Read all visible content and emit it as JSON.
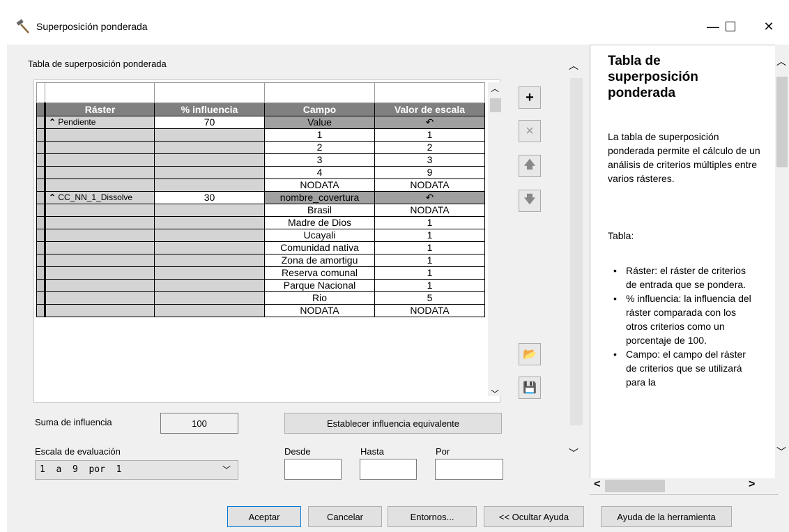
{
  "window": {
    "title": "Superposición ponderada",
    "minimize_icon": "minimize-icon",
    "maximize_icon": "maximize-icon",
    "close_icon": "close-icon"
  },
  "table_title": "Tabla de superposición ponderada",
  "headers": [
    "Ráster",
    "% influencia",
    "Campo",
    "Valor de escala"
  ],
  "rows": [
    {
      "type": "raster",
      "raster": "Pendiente",
      "influence": "70",
      "field": "Value",
      "scale": "↶"
    },
    {
      "type": "value",
      "field": "1",
      "scale": "1"
    },
    {
      "type": "value",
      "field": "2",
      "scale": "2"
    },
    {
      "type": "value",
      "field": "3",
      "scale": "3"
    },
    {
      "type": "value",
      "field": "4",
      "scale": "9"
    },
    {
      "type": "value",
      "field": "NODATA",
      "scale": "NODATA"
    },
    {
      "type": "raster",
      "raster": "CC_NN_1_Dissolve",
      "influence": "30",
      "field": "nombre_covertura",
      "scale": "↶"
    },
    {
      "type": "value",
      "field": "Brasil",
      "scale": "NODATA"
    },
    {
      "type": "value",
      "field": "Madre de Dios",
      "scale": "1"
    },
    {
      "type": "value",
      "field": "Ucayali",
      "scale": "1"
    },
    {
      "type": "value",
      "field": "Comunidad nativa",
      "scale": "1"
    },
    {
      "type": "value",
      "field": "Zona de amortigu",
      "scale": "1"
    },
    {
      "type": "value",
      "field": "Reserva comunal",
      "scale": "1"
    },
    {
      "type": "value",
      "field": "Parque Nacional",
      "scale": "1"
    },
    {
      "type": "value",
      "field": "Rio",
      "scale": "5"
    },
    {
      "type": "value",
      "field": "NODATA",
      "scale": "NODATA"
    }
  ],
  "side_buttons": {
    "add": "+",
    "remove": "×",
    "up": "🡅",
    "down": "🡇",
    "open": "📂",
    "save": "💾"
  },
  "sum_label": "Suma de influencia",
  "sum_value": "100",
  "equal_influence_button": "Establecer influencia equivalente",
  "scale_label": "Escala de evaluación",
  "scale_value": "1  a  9  por  1",
  "from_label": "Desde",
  "to_label": "Hasta",
  "by_label": "Por",
  "help": {
    "title": "Tabla de superposición ponderada",
    "intro": "La tabla de superposición ponderada permite el cálculo de un análisis de criterios múltiples entre varios rásteres.",
    "tabla": "Tabla:",
    "items": [
      "Ráster: el ráster de criterios de entrada que se pondera.",
      "% influencia: la influencia del ráster comparada con los otros criterios como un porcentaje de 100.",
      "Campo: el campo del ráster de criterios que se utilizará para la"
    ]
  },
  "footer": {
    "ok": "Aceptar",
    "cancel": "Cancelar",
    "environments": "Entornos...",
    "hide_help": "<< Ocultar Ayuda",
    "tool_help": "Ayuda de la herramienta"
  }
}
